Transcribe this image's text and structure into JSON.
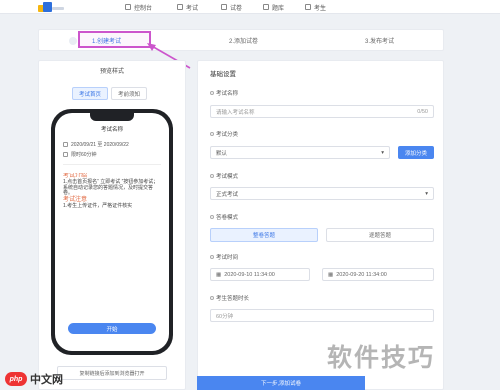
{
  "nav": {
    "items": [
      "控制台",
      "考试",
      "试卷",
      "题库",
      "考生"
    ]
  },
  "steps": {
    "items": [
      "1.创建考试",
      "2.添加试卷",
      "3.发布考试"
    ],
    "active_index": 0
  },
  "left_panel": {
    "title": "预览样式",
    "tabs": [
      "考试首页",
      "考前须知"
    ],
    "phone": {
      "exam_name": "考试名称",
      "date_range": "2020/09/21 至 2020/09/22",
      "validity": "限时60分钟",
      "notice_heading": "考试介绍",
      "notice_lines": [
        "1.点击首页报名“ 立即考试 ”按钮参加考试；系统自动记录您的答题情况，及时提交答卷。",
        "考试注意",
        "1.考生上传证件，严格证件核实"
      ],
      "start_button": "开始"
    },
    "link_box": "复制链接后添加到浏览器打开"
  },
  "right_panel": {
    "section_title": "基础设置",
    "exam_name_label": "考试名称",
    "exam_name_placeholder": "请输入考试名称",
    "exam_name_counter": "0/50",
    "category_label": "考试分类",
    "category_value": "默认",
    "add_category_button": "添加分类",
    "type_label": "考试模式",
    "type_value": "正式考试",
    "mode_label": "答卷模式",
    "mode_options": [
      "整卷答题",
      "逐题答题"
    ],
    "time_label": "考试时间",
    "start_time": "2020-09-10 11:34:00",
    "end_time": "2020-09-20 11:34:00",
    "duration_label": "考生答题时长",
    "duration_placeholder": "60分钟",
    "save_button": "下一步,添加试卷"
  },
  "watermark": "软件技巧",
  "site_logo": {
    "badge": "php",
    "text": "中文网"
  }
}
